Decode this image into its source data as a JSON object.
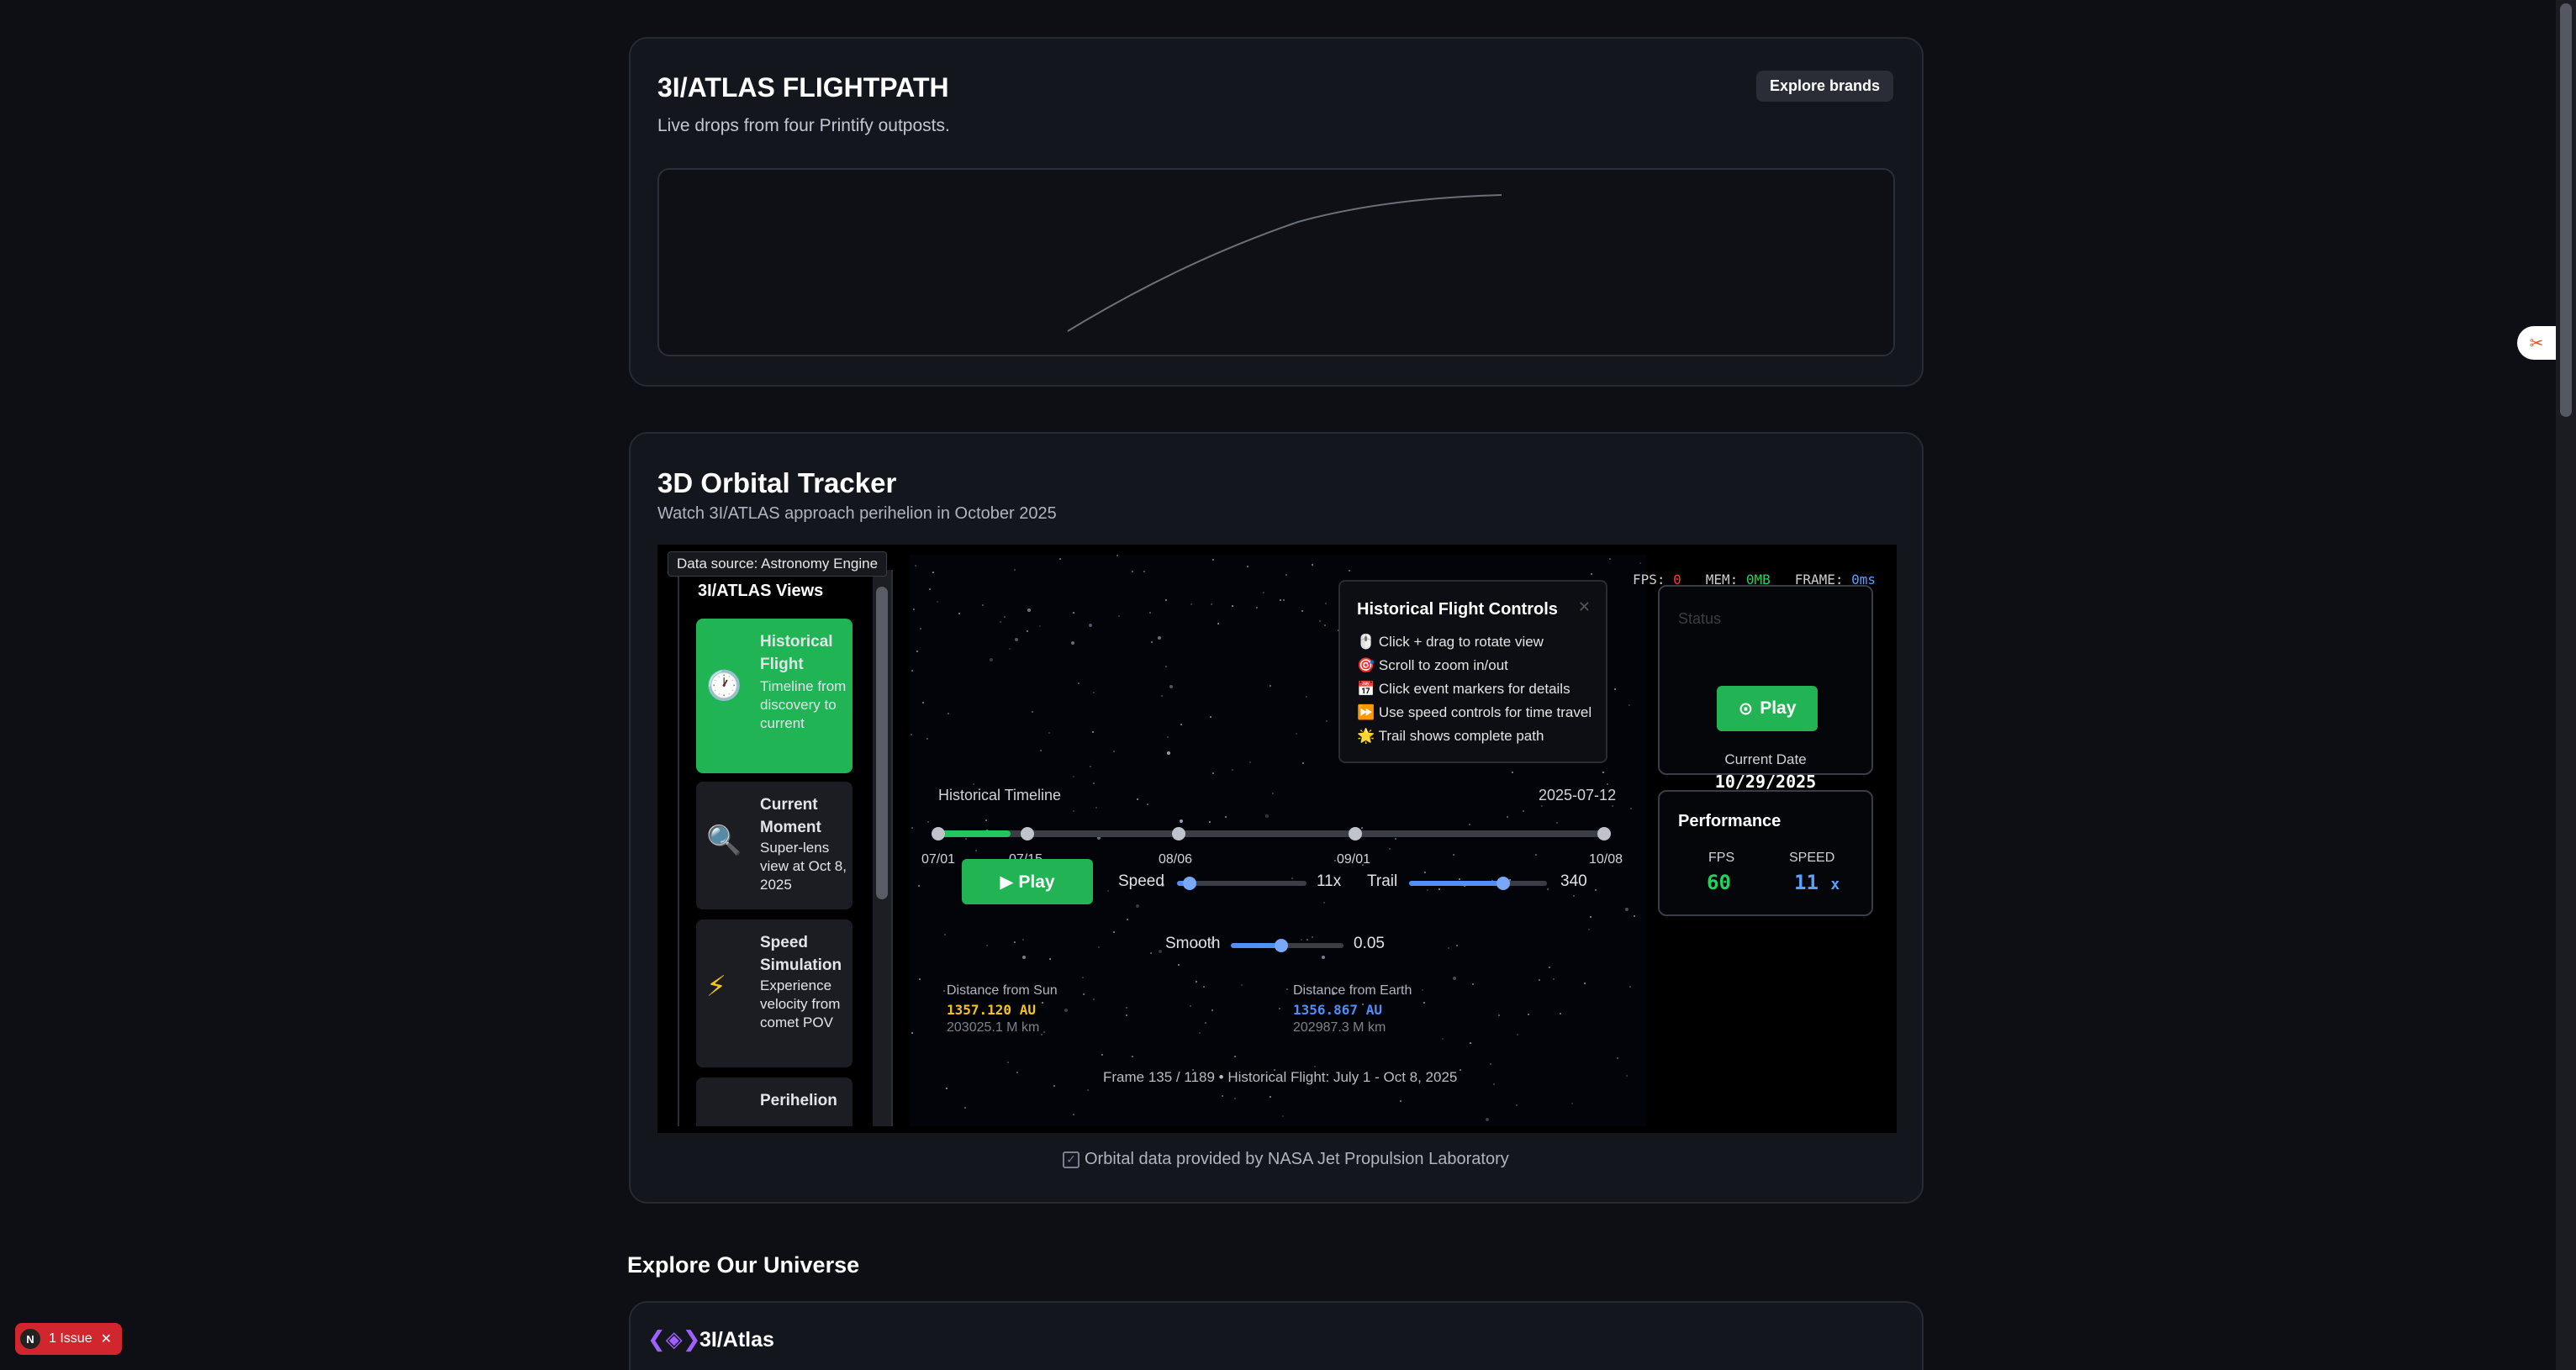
{
  "flightpath": {
    "title": "3I/ATLAS FLIGHTPATH",
    "subtitle": "Live drops from four Printify outposts.",
    "explore_brands": "Explore brands"
  },
  "tracker": {
    "title": "3D Orbital Tracker",
    "subtitle": "Watch 3I/ATLAS approach perihelion in October 2025",
    "data_source": "Data source: Astronomy Engine",
    "views_title": "3I/ATLAS Views",
    "views": [
      {
        "icon": "clock-icon",
        "glyph": "🕐",
        "name": "Historical Flight",
        "desc": "Timeline from discovery to current",
        "active": true
      },
      {
        "icon": "magnifier-icon",
        "glyph": "🔍",
        "name": "Current Moment",
        "desc": "Super-lens view at Oct 8, 2025",
        "active": false
      },
      {
        "icon": "lightning-icon",
        "glyph": "⚡",
        "name": "Speed Simulation",
        "desc": "Experience velocity from comet POV",
        "active": false
      },
      {
        "icon": "",
        "glyph": "",
        "name": "Perihelion",
        "desc": "",
        "active": false
      }
    ],
    "controls_help": {
      "title": "Historical Flight Controls",
      "items": [
        "🖱️ Click + drag to rotate view",
        "🎯 Scroll to zoom in/out",
        "📅 Click event markers for details",
        "⏩ Use speed controls for time travel",
        "🌟 Trail shows complete path"
      ]
    },
    "stats": {
      "fps_label": "FPS:",
      "fps": "0",
      "mem_label": "MEM:",
      "mem": "0MB",
      "frame_label": "FRAME:",
      "frame": "0ms"
    },
    "status": {
      "label": "Status",
      "play_label": "Play",
      "current_date_label": "Current Date",
      "current_date": "10/29/2025"
    },
    "performance": {
      "title": "Performance",
      "fps_label": "FPS",
      "fps_value": "60",
      "speed_label": "SPEED",
      "speed_value": "11",
      "speed_unit": "x"
    },
    "timeline": {
      "label": "Historical Timeline",
      "date": "2025-07-12",
      "ticks": [
        "07/01",
        "07/15",
        "08/06",
        "09/01",
        "10/08"
      ],
      "progress": 0.11
    },
    "play_label": "▶ Play",
    "speed": {
      "label": "Speed",
      "value_text": "11x",
      "fraction": 0.1
    },
    "trail": {
      "label": "Trail",
      "value_text": "340",
      "fraction": 0.68
    },
    "smooth": {
      "label": "Smooth",
      "value_text": "0.05",
      "fraction": 0.45
    },
    "distance_sun": {
      "label": "Distance from Sun",
      "au": "1357.120 AU",
      "km": "203025.1 M km",
      "color": "#f5c518"
    },
    "distance_earth": {
      "label": "Distance from Earth",
      "au": "1356.867 AU",
      "km": "202987.3 M km",
      "color": "#4f8ff7"
    },
    "frame_text": "Frame 135 / 1189 • Historical Flight: July 1 - Oct 8, 2025",
    "attribution": "Orbital data provided by NASA Jet Propulsion Laboratory"
  },
  "explore": {
    "title": "Explore Our Universe",
    "first_card": "3I/Atlas"
  },
  "issue_badge": {
    "icon": "N",
    "label": "1 Issue"
  },
  "colors": {
    "accent_green": "#22b355",
    "background": "#0d0f15",
    "card": "#14161d"
  }
}
